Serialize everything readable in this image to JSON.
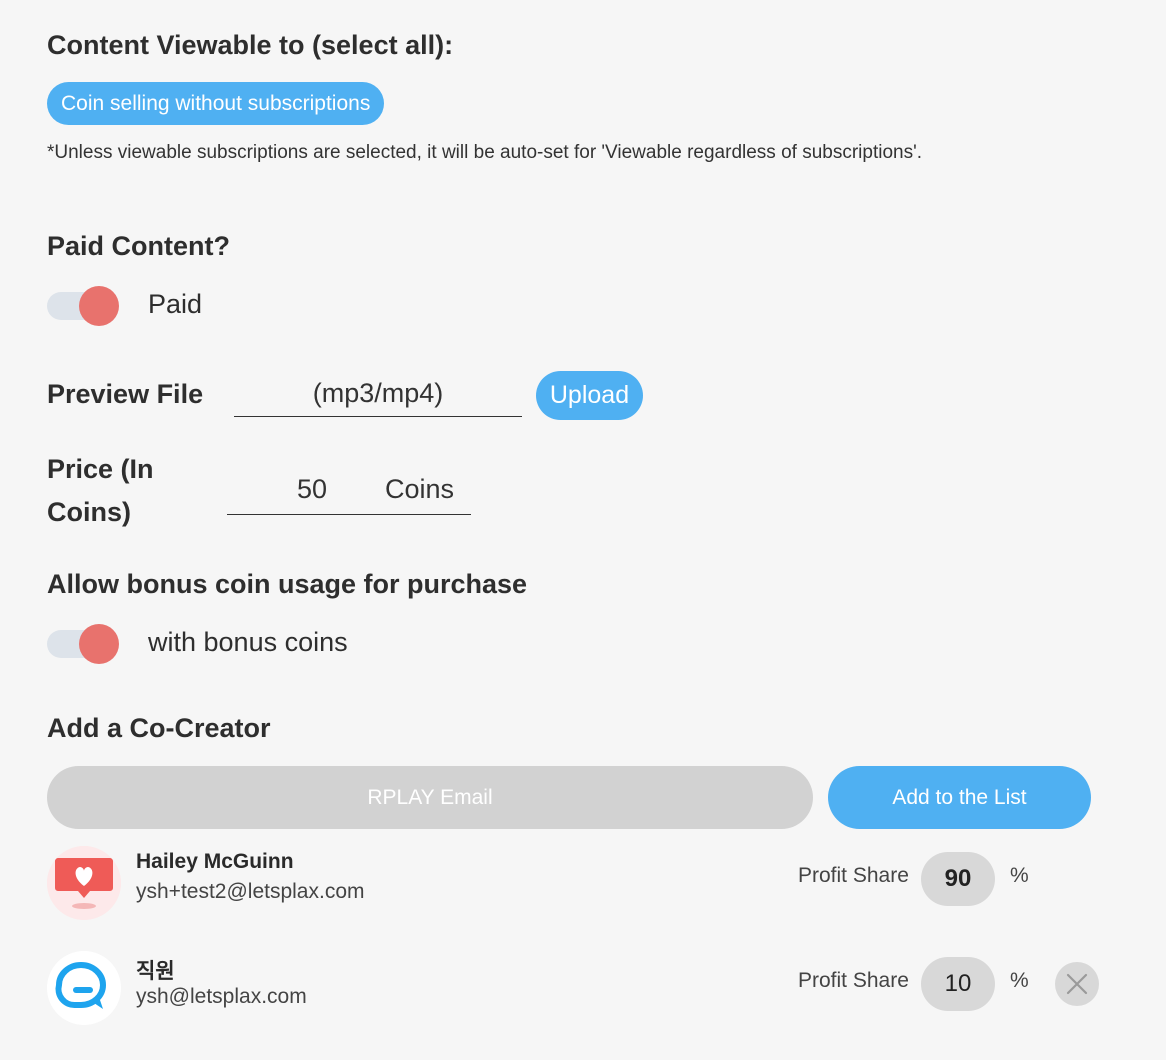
{
  "viewable": {
    "heading": "Content Viewable to (select all):",
    "chip_label": "Coin selling without subscriptions",
    "note": "*Unless viewable subscriptions are selected, it will be auto-set for 'Viewable regardless of subscriptions'."
  },
  "paid": {
    "heading": "Paid Content?",
    "toggle_on": true,
    "toggle_label": "Paid"
  },
  "preview": {
    "label": "Preview File",
    "placeholder": "(mp3/mp4)",
    "upload_label": "Upload"
  },
  "price": {
    "label_line1": "Price (In",
    "label_line2": "Coins)",
    "value": "50",
    "unit": "Coins"
  },
  "bonus": {
    "heading": "Allow bonus coin usage for purchase",
    "toggle_on": true,
    "toggle_label": "with bonus coins"
  },
  "cocreator": {
    "heading": "Add a Co-Creator",
    "email_placeholder": "RPLAY Email",
    "add_label": "Add to the List",
    "profit_share_label": "Profit Share",
    "percent_sign": "%",
    "list": [
      {
        "name": "Hailey McGuinn",
        "email": "ysh+test2@letsplax.com",
        "share": "90",
        "avatar_icon": "heart-chat-icon",
        "removable": false
      },
      {
        "name": "직원",
        "email": "ysh@letsplax.com",
        "share": "10",
        "avatar_icon": "chat-bubble-icon",
        "removable": true
      }
    ]
  },
  "colors": {
    "accent": "#4fb0f2",
    "toggle_knob": "#e8726d",
    "disabled": "#d2d2d2"
  }
}
